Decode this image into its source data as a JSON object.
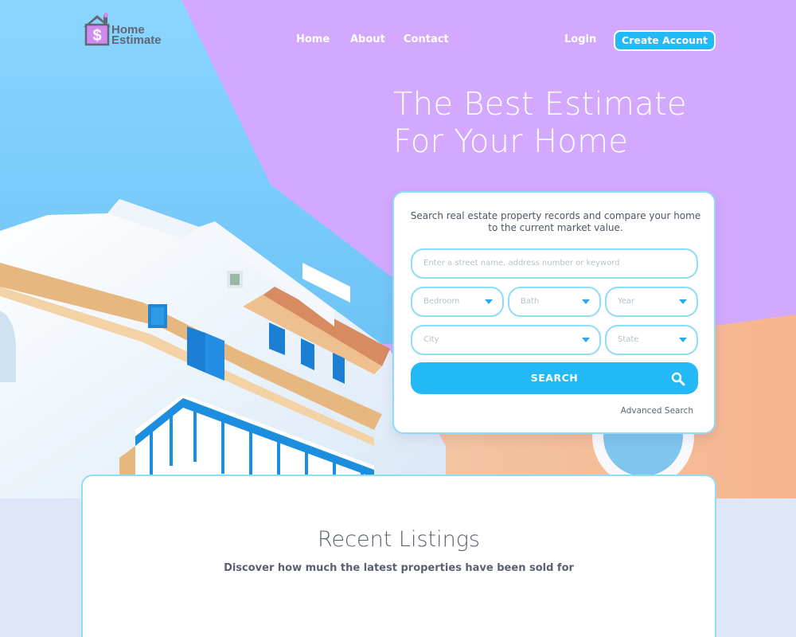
{
  "brand": {
    "line1": "Home",
    "line2": "Estimate",
    "icon": "house-dollar-icon"
  },
  "nav": {
    "home": "Home",
    "about": "About",
    "contact": "Contact",
    "login": "Login",
    "create_account": "Create Account"
  },
  "hero": {
    "headline_line1": "The Best Estimate",
    "headline_line2": "For Your Home"
  },
  "search": {
    "description": "Search real estate property records and compare your home to the current market value.",
    "street_placeholder": "Enter a street name, address number or keyword",
    "bedroom": "Bedroom",
    "bath": "Bath",
    "year": "Year",
    "city": "City",
    "state": "State",
    "button": "SEARCH",
    "advanced": "Advanced Search"
  },
  "listings": {
    "title": "Recent Listings",
    "subtitle": "Discover how much the latest properties have been sold for"
  },
  "colors": {
    "accent": "#23b9f6",
    "purple": "#d3a8ff",
    "sky": "#7fd0fa",
    "border": "#8fdcfa"
  }
}
